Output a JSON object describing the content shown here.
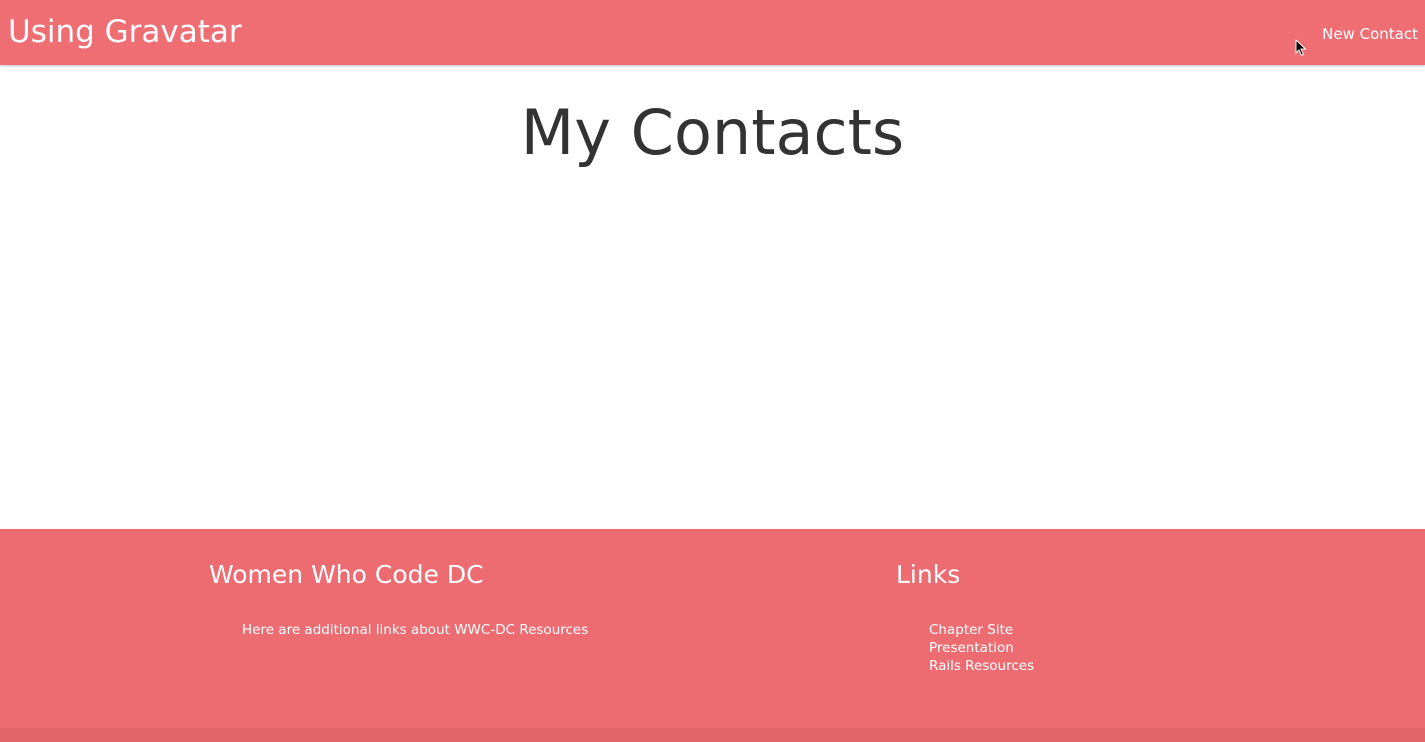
{
  "navbar": {
    "brand": "Using Gravatar",
    "new_contact_label": "New Contact",
    "background_color": "#ef6e74"
  },
  "main": {
    "title": "My Contacts"
  },
  "footer": {
    "background_color": "#ec6c72",
    "left": {
      "heading": "Women Who Code DC",
      "text": "Here are additional links about WWC-DC Resources"
    },
    "right": {
      "heading": "Links",
      "links": [
        {
          "label": "Chapter Site"
        },
        {
          "label": "Presentation"
        },
        {
          "label": "Rails Resources"
        }
      ]
    }
  }
}
